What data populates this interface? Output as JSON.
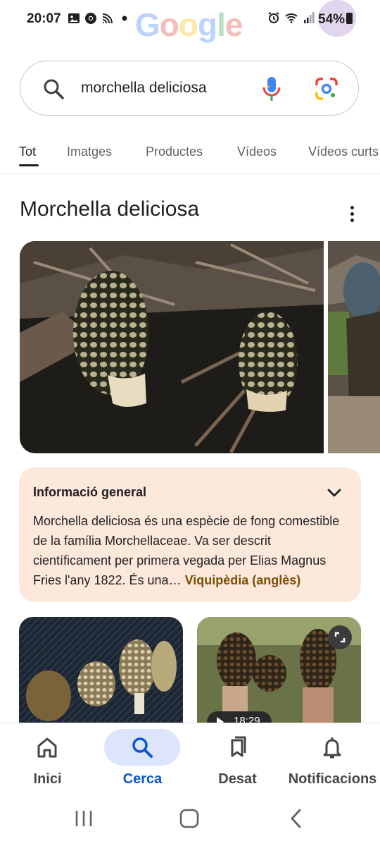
{
  "status_bar": {
    "time": "20:07",
    "battery": "54%",
    "left_icons": [
      "image-icon",
      "chrome-icon",
      "cast-icon",
      "dot-icon"
    ],
    "right_icons": [
      "alarm-icon",
      "wifi-icon",
      "signal-icon",
      "battery-icon"
    ]
  },
  "logo": {
    "text": "Google"
  },
  "search": {
    "query": "morchella deliciosa",
    "icons": [
      "search-icon",
      "mic-icon",
      "google-lens-icon"
    ]
  },
  "tabs": [
    {
      "label": "Tot",
      "active": true
    },
    {
      "label": "Imatges",
      "active": false
    },
    {
      "label": "Productes",
      "active": false
    },
    {
      "label": "Vídeos",
      "active": false
    },
    {
      "label": "Vídeos curts",
      "active": false
    }
  ],
  "knowledge_panel": {
    "title": "Morchella deliciosa",
    "menu_icon": "more-vert-icon",
    "info": {
      "heading": "Informació general",
      "text": "Morchella deliciosa és una espècie de fong comestible de la família Morchellaceae. Va ser descrit científicament per primera vegada per Elias Magnus Fries l'any 1822. És una…",
      "link": "Viquipèdia (anglès)"
    },
    "video": {
      "duration": "18:29"
    }
  },
  "bottom_nav": [
    {
      "label": "Inici",
      "icon": "home-icon",
      "active": false
    },
    {
      "label": "Cerca",
      "icon": "search-icon",
      "active": true
    },
    {
      "label": "Desat",
      "icon": "bookmarks-icon",
      "active": false
    },
    {
      "label": "Notificacions",
      "icon": "bell-icon",
      "active": false
    }
  ],
  "colors": {
    "accent": "#0b57d0",
    "info_card_bg": "#fde8dc",
    "wiki_link": "#7a4f00",
    "active_nav_bg": "#dce5fb"
  }
}
